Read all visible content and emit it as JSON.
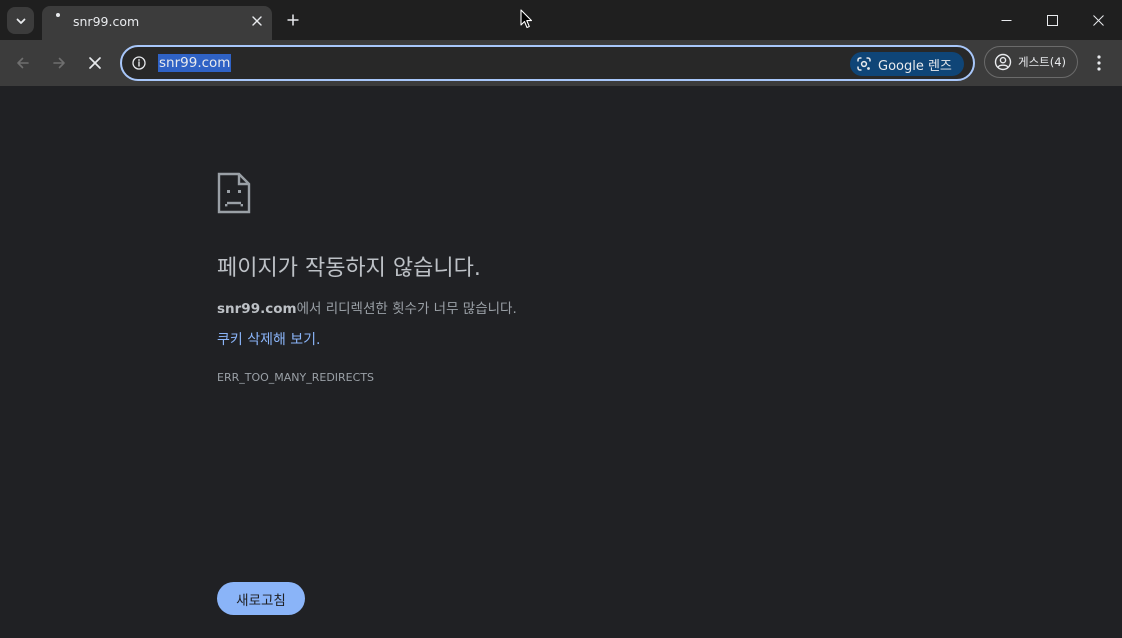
{
  "tab": {
    "title": "snr99.com"
  },
  "omnibox": {
    "url": "snr99.com",
    "lens_label": "Google 렌즈"
  },
  "profile": {
    "label": "게스트(4)"
  },
  "error": {
    "title": "페이지가 작동하지 않습니다.",
    "host": "snr99.com",
    "detail_suffix": "에서 리디렉션한 횟수가 너무 많습니다.",
    "link": "쿠키 삭제해 보기.",
    "code": "ERR_TOO_MANY_REDIRECTS",
    "reload_label": "새로고침"
  },
  "colors": {
    "page_bg": "#202124",
    "toolbar_bg": "#3c3c3c",
    "accent": "#8ab4f8",
    "omnibox_border": "#a8c7fa"
  },
  "icons": {
    "tab_search": "chevron-down-icon",
    "favicon": "loading-dot-icon",
    "tab_close": "close-icon",
    "new_tab": "plus-icon",
    "minimize": "minimize-icon",
    "maximize": "maximize-icon",
    "close": "close-icon",
    "back": "arrow-left-icon",
    "forward": "arrow-right-icon",
    "stop": "stop-icon",
    "site_info": "info-icon",
    "lens": "google-lens-icon",
    "profile": "profile-icon",
    "menu": "kebab-menu-icon",
    "sad_page": "sad-page-icon"
  }
}
